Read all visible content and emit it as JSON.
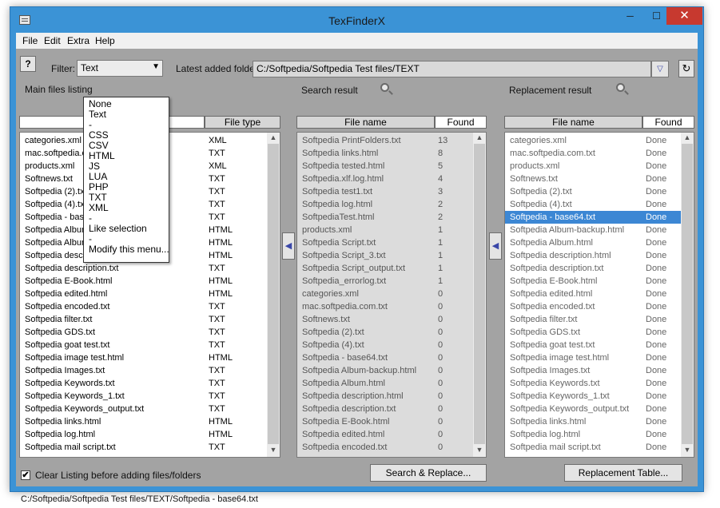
{
  "window": {
    "title": "TexFinderX",
    "min": "─",
    "max": "☐",
    "close": "✕"
  },
  "menu": [
    "File",
    "Edit",
    "Extra",
    "Help"
  ],
  "toolbar": {
    "help_label": "?",
    "filter_label": "Filter:",
    "filter_value": "Text",
    "latest_folder_label": "Latest added folder:",
    "latest_folder_value": "C:/Softpedia/Softpedia Test files/TEXT",
    "dropdown_glyph": "▽",
    "refresh_glyph": "↻"
  },
  "filter_menu": [
    "None",
    "Text",
    "-",
    "CSS",
    "CSV",
    "HTML",
    "JS",
    "LUA",
    "PHP",
    "TXT",
    "XML",
    "-",
    "Like selection",
    "-",
    "Modify this menu..."
  ],
  "main_files": {
    "label": "Main files listing",
    "filter_text": "",
    "col_type": "File type",
    "rows": [
      [
        "categories.xml",
        "XML"
      ],
      [
        "mac.softpedia.com.txt",
        "TXT"
      ],
      [
        "products.xml",
        "XML"
      ],
      [
        "Softnews.txt",
        "TXT"
      ],
      [
        "Softpedia (2).txt",
        "TXT"
      ],
      [
        "Softpedia (4).txt",
        "TXT"
      ],
      [
        "Softpedia - base64.txt",
        "TXT"
      ],
      [
        "Softpedia Album-backup.html",
        "HTML"
      ],
      [
        "Softpedia Album.html",
        "HTML"
      ],
      [
        "Softpedia description.html",
        "HTML"
      ],
      [
        "Softpedia description.txt",
        "TXT"
      ],
      [
        "Softpedia E-Book.html",
        "HTML"
      ],
      [
        "Softpedia edited.html",
        "HTML"
      ],
      [
        "Softpedia encoded.txt",
        "TXT"
      ],
      [
        "Softpedia filter.txt",
        "TXT"
      ],
      [
        "Softpedia GDS.txt",
        "TXT"
      ],
      [
        "Softpedia goat test.txt",
        "TXT"
      ],
      [
        "Softpedia image test.html",
        "HTML"
      ],
      [
        "Softpedia Images.txt",
        "TXT"
      ],
      [
        "Softpedia Keywords.txt",
        "TXT"
      ],
      [
        "Softpedia Keywords_1.txt",
        "TXT"
      ],
      [
        "Softpedia Keywords_output.txt",
        "TXT"
      ],
      [
        "Softpedia links.html",
        "HTML"
      ],
      [
        "Softpedia log.html",
        "HTML"
      ],
      [
        "Softpedia mail script.txt",
        "TXT"
      ]
    ]
  },
  "search_result": {
    "label": "Search result",
    "col_name": "File name",
    "col_found": "Found",
    "rows": [
      [
        "Softpedia PrintFolders.txt",
        "13"
      ],
      [
        "Softpedia links.html",
        "8"
      ],
      [
        "Softpedia tested.html",
        "5"
      ],
      [
        "Softpedia.xlf.log.html",
        "4"
      ],
      [
        "Softpedia test1.txt",
        "3"
      ],
      [
        "Softpedia log.html",
        "2"
      ],
      [
        "SoftpediaTest.html",
        "2"
      ],
      [
        "products.xml",
        "1"
      ],
      [
        "Softpedia Script.txt",
        "1"
      ],
      [
        "Softpedia Script_3.txt",
        "1"
      ],
      [
        "Softpedia Script_output.txt",
        "1"
      ],
      [
        "Softpedia_errorlog.txt",
        "1"
      ],
      [
        "categories.xml",
        "0"
      ],
      [
        "mac.softpedia.com.txt",
        "0"
      ],
      [
        "Softnews.txt",
        "0"
      ],
      [
        "Softpedia (2).txt",
        "0"
      ],
      [
        "Softpedia (4).txt",
        "0"
      ],
      [
        "Softpedia - base64.txt",
        "0"
      ],
      [
        "Softpedia Album-backup.html",
        "0"
      ],
      [
        "Softpedia Album.html",
        "0"
      ],
      [
        "Softpedia description.html",
        "0"
      ],
      [
        "Softpedia description.txt",
        "0"
      ],
      [
        "Softpedia E-Book.html",
        "0"
      ],
      [
        "Softpedia edited.html",
        "0"
      ],
      [
        "Softpedia encoded.txt",
        "0"
      ]
    ]
  },
  "replacement_result": {
    "label": "Replacement result",
    "col_name": "File name",
    "col_found": "Found",
    "selected_index": 6,
    "rows": [
      [
        "categories.xml",
        "Done"
      ],
      [
        "mac.softpedia.com.txt",
        "Done"
      ],
      [
        "products.xml",
        "Done"
      ],
      [
        "Softnews.txt",
        "Done"
      ],
      [
        "Softpedia (2).txt",
        "Done"
      ],
      [
        "Softpedia (4).txt",
        "Done"
      ],
      [
        "Softpedia - base64.txt",
        "Done"
      ],
      [
        "Softpedia Album-backup.html",
        "Done"
      ],
      [
        "Softpedia Album.html",
        "Done"
      ],
      [
        "Softpedia description.html",
        "Done"
      ],
      [
        "Softpedia description.txt",
        "Done"
      ],
      [
        "Softpedia E-Book.html",
        "Done"
      ],
      [
        "Softpedia edited.html",
        "Done"
      ],
      [
        "Softpedia encoded.txt",
        "Done"
      ],
      [
        "Softpedia filter.txt",
        "Done"
      ],
      [
        "Softpedia GDS.txt",
        "Done"
      ],
      [
        "Softpedia goat test.txt",
        "Done"
      ],
      [
        "Softpedia image test.html",
        "Done"
      ],
      [
        "Softpedia Images.txt",
        "Done"
      ],
      [
        "Softpedia Keywords.txt",
        "Done"
      ],
      [
        "Softpedia Keywords_1.txt",
        "Done"
      ],
      [
        "Softpedia Keywords_output.txt",
        "Done"
      ],
      [
        "Softpedia links.html",
        "Done"
      ],
      [
        "Softpedia log.html",
        "Done"
      ],
      [
        "Softpedia mail script.txt",
        "Done"
      ]
    ]
  },
  "bottom": {
    "clear_listing_label": "Clear Listing before adding files/folders",
    "clear_listing_checked": "✔",
    "search_replace_label": "Search & Replace...",
    "replacement_table_label": "Replacement Table...",
    "status_path": "C:/Softpedia/Softpedia Test files/TEXT/Softpedia - base64.txt"
  },
  "colors": {
    "titlebar": "#3b93d6",
    "selection": "#3c87d4",
    "close": "#c7392f"
  }
}
